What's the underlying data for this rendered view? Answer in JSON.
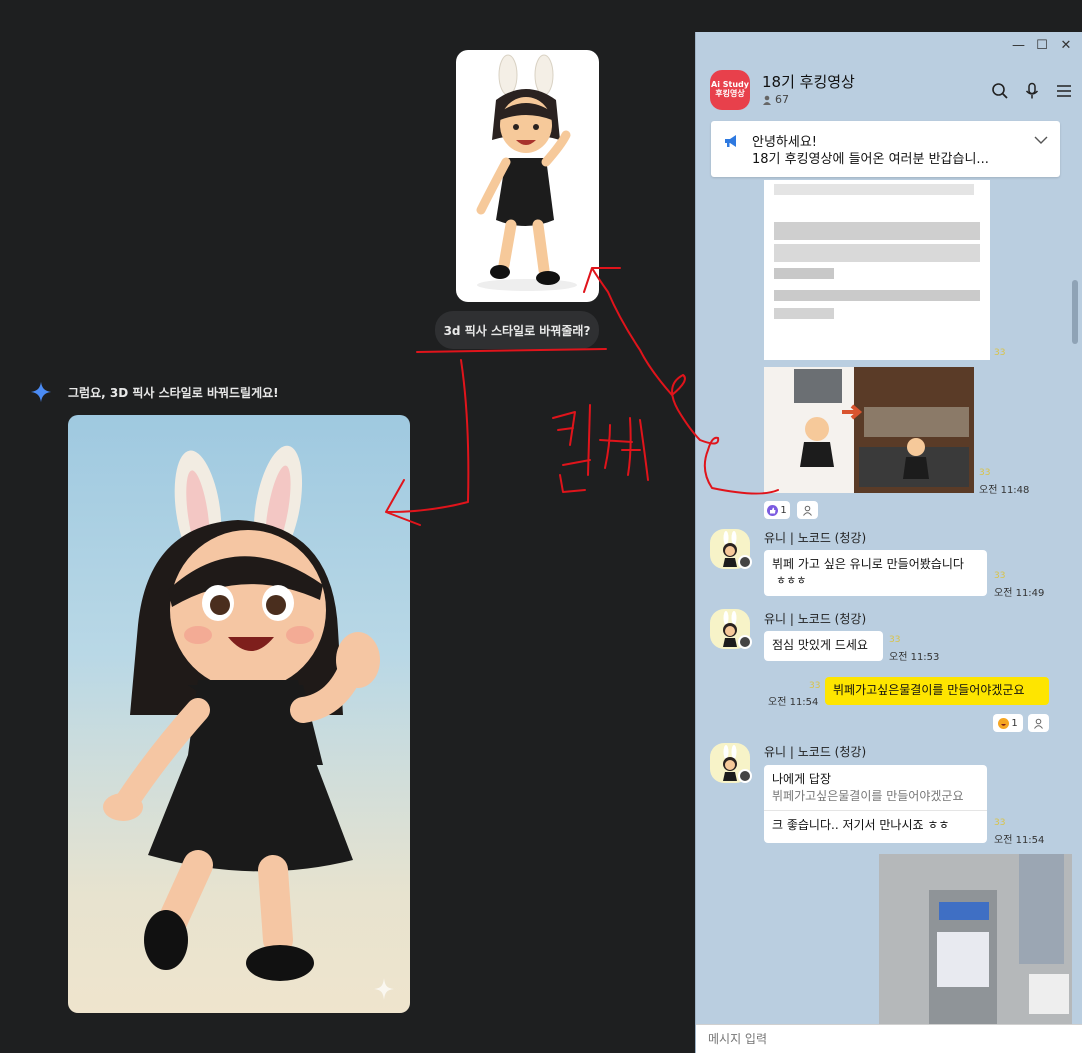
{
  "gemini": {
    "user_prompt": "3d 픽사 스타일로 바꿔줄래?",
    "ai_reply": "그럼요, 3D 픽사 스타일로 바꿔드릴게요!"
  },
  "annotation": {
    "handwritten": "캡처",
    "color": "#e0141b"
  },
  "kakao": {
    "window_controls": [
      "—",
      "☐",
      "✕"
    ],
    "room": {
      "avatar_line1": "Ai Study",
      "avatar_line2": "후킹영상",
      "title": "18기 후킹영상",
      "members": "67"
    },
    "notice": {
      "line1": "안녕하세요!",
      "line2": "18기 후킹영상에 들어온 여러분 반갑습니..."
    },
    "messages": {
      "card_unread": "33",
      "image_unread": "33",
      "image_time": "오전 11:48",
      "image_reactions": {
        "like": "1"
      },
      "m1": {
        "sender": "유니 | 노코드 (청강)",
        "text_line1": "뷔페 가고 싶은 유니로 만들어봤습니다",
        "text_line2": "ㅎㅎㅎ",
        "unread": "33",
        "time": "오전 11:49"
      },
      "m2": {
        "sender": "유니 | 노코드 (청강)",
        "text": "점심 맛있게 드세요",
        "unread": "33",
        "time": "오전 11:53"
      },
      "mine": {
        "text": "뷔페가고싶은물결이를 만들어야겠군요",
        "unread": "33",
        "time": "오전 11:54",
        "reaction": "1"
      },
      "m3": {
        "sender": "유니 | 노코드 (청강)",
        "reply_to_label": "나에게 답장",
        "reply_to_text": "뷔페가고싶은물결이를 만들어야겠군요",
        "text": "크 좋습니다.. 저기서 만나시죠 ㅎㅎ",
        "unread": "33",
        "time": "오전 11:54"
      }
    },
    "input": {
      "placeholder": "메시지 입력"
    }
  },
  "colors": {
    "kakao_bg": "#bacee0",
    "my_bubble": "#fee500",
    "room_avatar": "#e8404b",
    "left_bg": "#1e1f20",
    "gemini_star": "#4b8bf4"
  }
}
